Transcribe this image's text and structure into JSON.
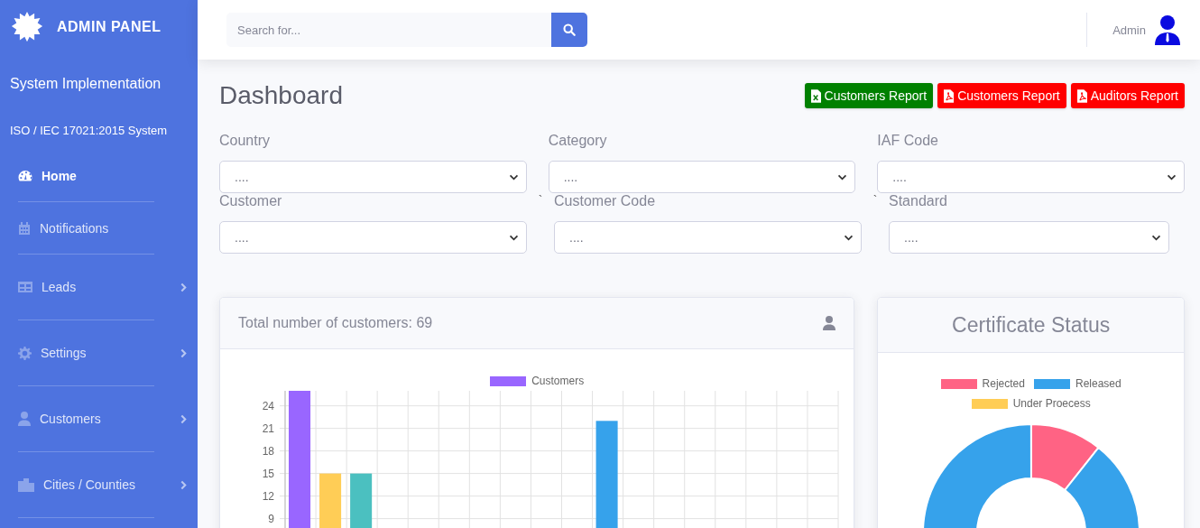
{
  "sidebar": {
    "brand": "ADMIN PANEL",
    "subtitle": "System Implementation",
    "system": "ISO / IEC 17021:2015 System",
    "items": [
      {
        "label": "Home",
        "selected": true,
        "expandable": false
      },
      {
        "label": "Notifications",
        "selected": false,
        "expandable": false
      },
      {
        "label": "Leads",
        "selected": false,
        "expandable": true
      },
      {
        "label": "Settings",
        "selected": false,
        "expandable": true
      },
      {
        "label": "Customers",
        "selected": false,
        "expandable": true
      },
      {
        "label": "Cities / Counties",
        "selected": false,
        "expandable": true
      }
    ]
  },
  "topbar": {
    "search": {
      "placeholder": "Search for..."
    },
    "user": {
      "name": "Admin"
    }
  },
  "page": {
    "title": "Dashboard",
    "report_buttons": [
      {
        "label": "Customers Report",
        "kind": "excel"
      },
      {
        "label": "Customers Report",
        "kind": "pdf"
      },
      {
        "label": "Auditors Report",
        "kind": "pdf"
      }
    ]
  },
  "filter_rows": [
    [
      {
        "label": "Country",
        "value": "...."
      },
      {
        "label": "Category",
        "value": "...."
      },
      {
        "label": "IAF Code",
        "value": "...."
      }
    ],
    [
      {
        "label": "Customer",
        "value": "...."
      },
      {
        "prefix": "`",
        "label": "Customer Code",
        "value": "...."
      },
      {
        "prefix": "`",
        "label": "Standard",
        "value": "...."
      }
    ]
  ],
  "customers_card": {
    "title": "Total number of customers: 69",
    "chart_data": {
      "type": "bar",
      "grid": true,
      "ylim": [
        0,
        26
      ],
      "yticks": [
        9,
        12,
        15,
        18,
        21,
        24
      ],
      "series": [
        {
          "name": "Customers",
          "color": "#9966ff",
          "colors": [
            "#9966ff",
            "#ffcd56",
            "#4bc0c0",
            null,
            null,
            null,
            null,
            null,
            null,
            null,
            "#36a2eb",
            null,
            null,
            null,
            null,
            null,
            null,
            null
          ],
          "values": [
            26,
            15,
            15,
            null,
            null,
            null,
            null,
            null,
            null,
            null,
            22,
            null,
            null,
            null,
            null,
            null,
            null,
            null
          ]
        }
      ]
    }
  },
  "certificate_card": {
    "title": "Certificate Status",
    "legend": [
      {
        "label": "Rejected",
        "color": "#ff6384"
      },
      {
        "label": "Released",
        "color": "#36a2eb"
      },
      {
        "label": "Under Proecess",
        "color": "#ffcd56"
      }
    ]
  }
}
